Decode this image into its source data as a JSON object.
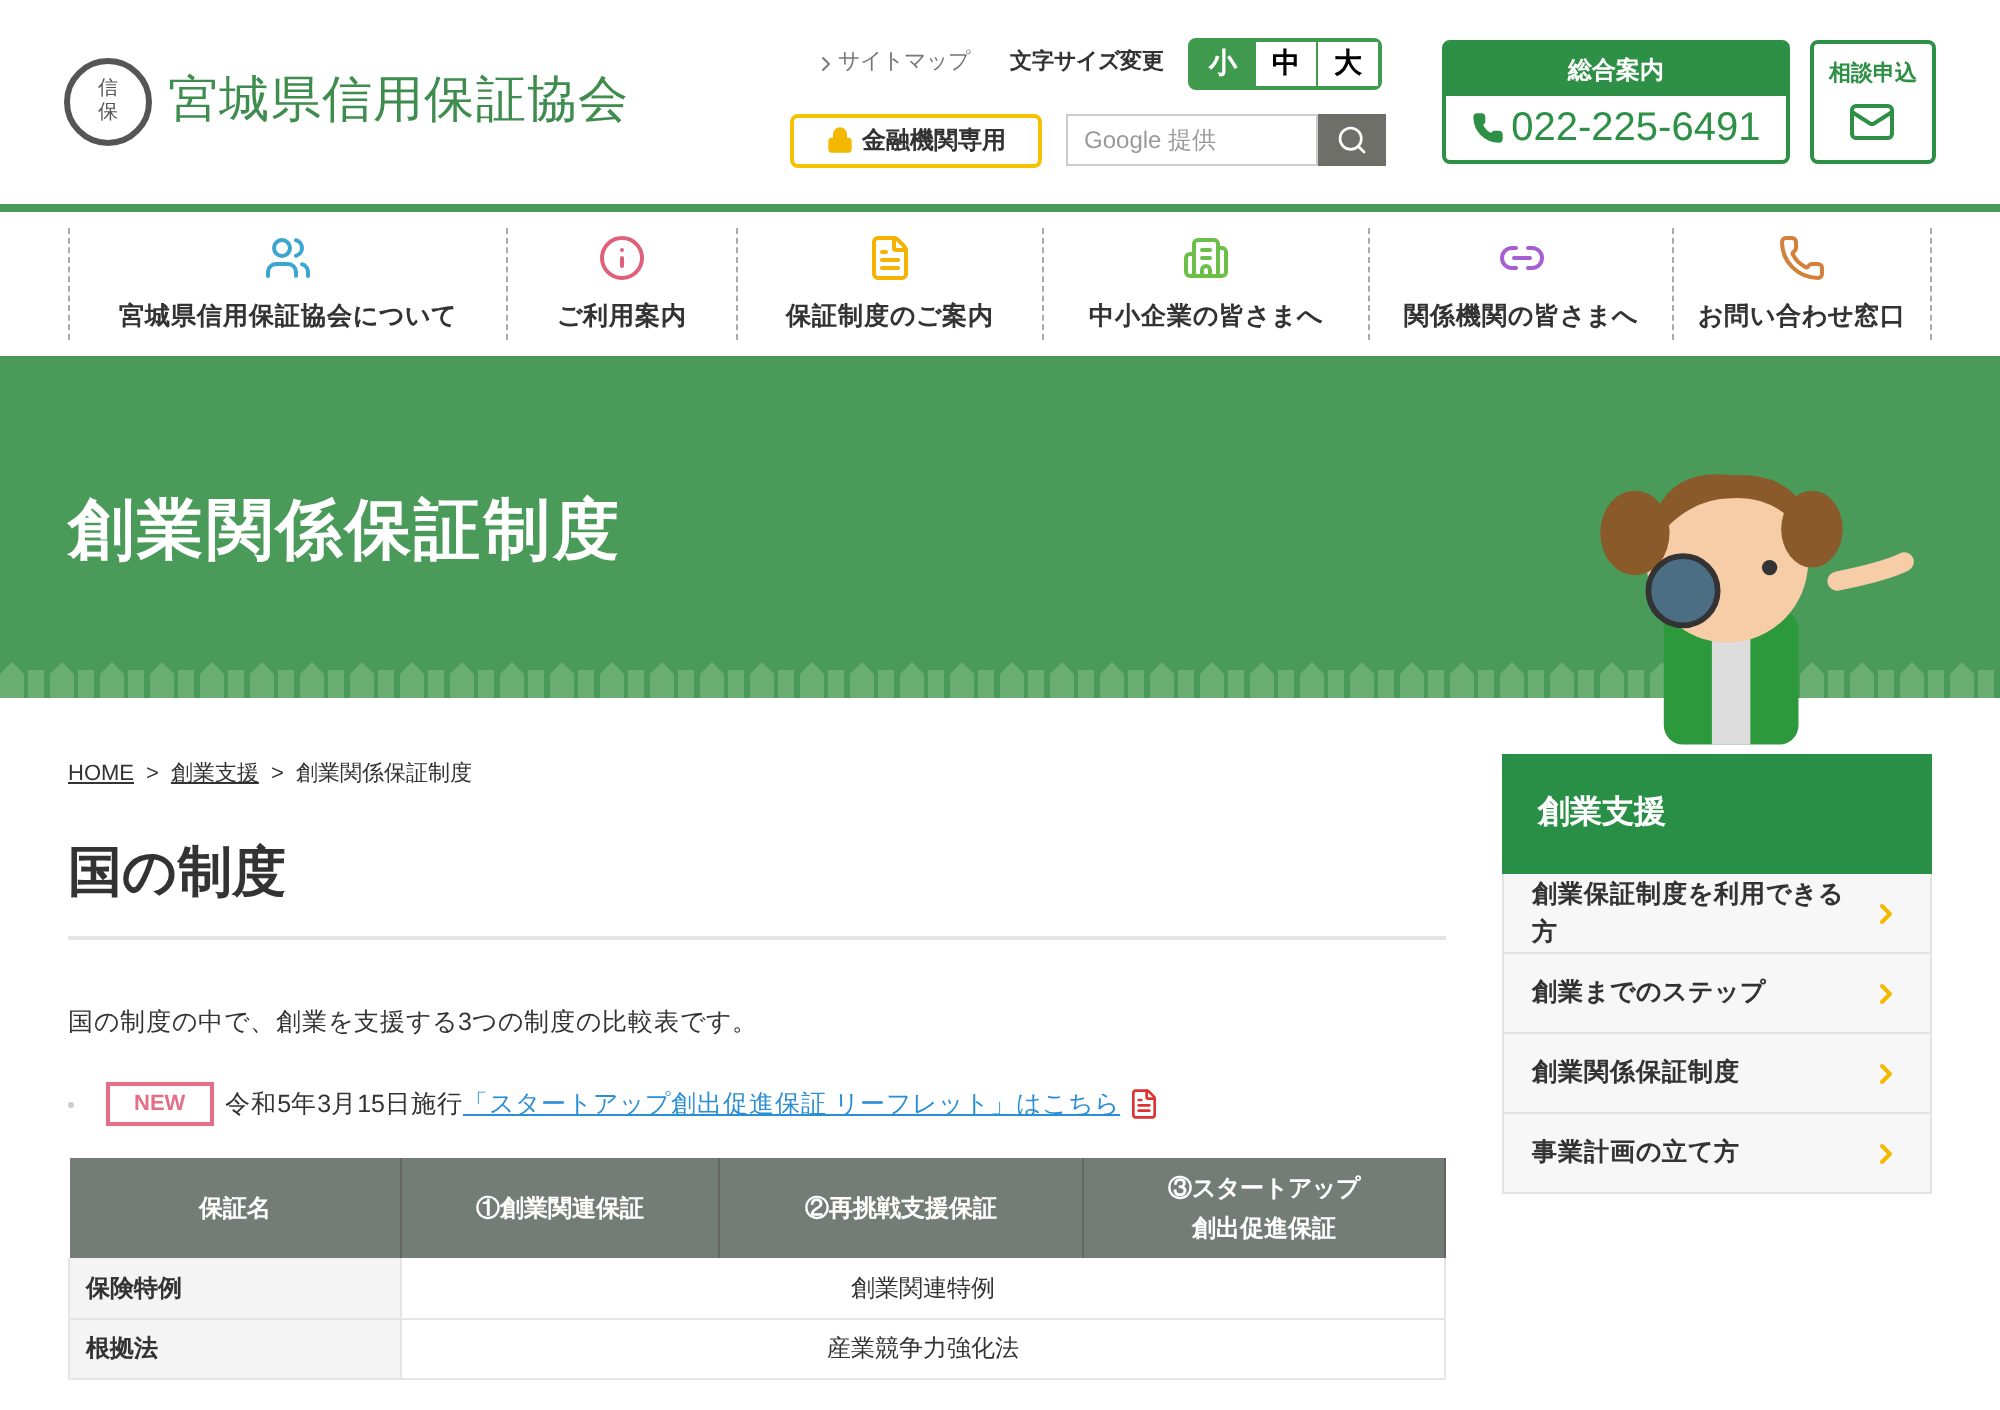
{
  "header": {
    "logo_emblem": [
      "信",
      "保"
    ],
    "site_name": "宮城県信用保証協会",
    "sitemap": "サイトマップ",
    "font_size_label": "文字サイズ変更",
    "font_sizes": [
      {
        "label": "小",
        "selected": true
      },
      {
        "label": "中",
        "selected": false
      },
      {
        "label": "大",
        "selected": false
      }
    ],
    "members_button": "金融機関専用",
    "search": {
      "placeholder": "Google 提供"
    },
    "contact": {
      "title": "総合案内",
      "phone": "022-225-6491"
    },
    "consult": "相談申込"
  },
  "nav": [
    {
      "label": "宮城県信用保証協会について",
      "kind": "people"
    },
    {
      "label": "ご利用案内",
      "kind": "info"
    },
    {
      "label": "保証制度のご案内",
      "kind": "document"
    },
    {
      "label": "中小企業の皆さまへ",
      "kind": "building"
    },
    {
      "label": "関係機関の皆さまへ",
      "kind": "link"
    },
    {
      "label": "お問い合わせ窓口",
      "kind": "phone"
    }
  ],
  "banner": {
    "title": "創業関係保証制度"
  },
  "breadcrumb": [
    {
      "label": "HOME",
      "link": true
    },
    {
      "label": "創業支援",
      "link": true
    },
    {
      "label": "創業関係保証制度",
      "link": false
    }
  ],
  "breadcrumb_separator": ">",
  "page_title": "国の制度",
  "intro": "国の制度の中で、創業を支援する3つの制度の比較表です。",
  "notice": {
    "badge": "NEW",
    "text": "令和5年3月15日施行",
    "link": "「スタートアップ創出促進保証 リーフレット」はこちら"
  },
  "table": {
    "columns": [
      "保証名",
      "①創業関連保証",
      "②再挑戦支援保証",
      [
        "③スタートアップ",
        "創出促進保証"
      ]
    ],
    "rows": [
      {
        "label": "保険特例",
        "value": "創業関連特例"
      },
      {
        "label": "根拠法",
        "value": "産業競争力強化法"
      }
    ]
  },
  "sidebar": {
    "title": "創業支援",
    "items": [
      "創業保証制度を利用できる方",
      "創業までのステップ",
      "創業関係保証制度",
      "事業計画の立て方"
    ]
  }
}
